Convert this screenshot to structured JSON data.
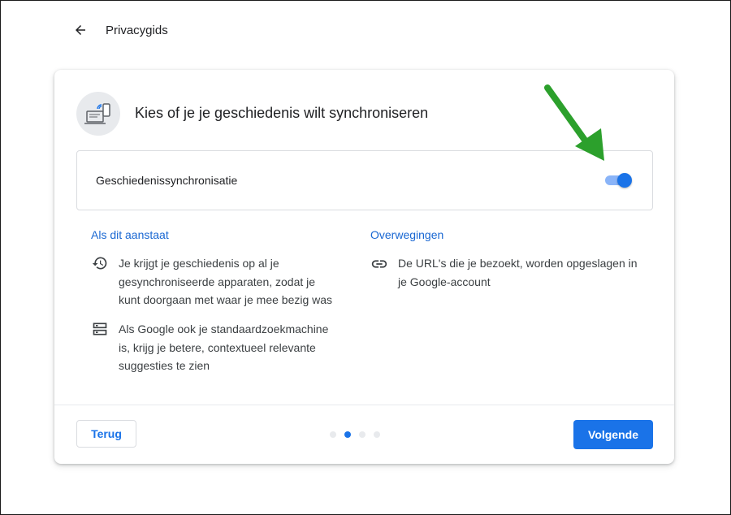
{
  "page": {
    "title": "Privacygids"
  },
  "card": {
    "title": "Kies of je je geschiedenis wilt synchroniseren",
    "toggle": {
      "label": "Geschiedenissynchronisatie",
      "state": "on"
    }
  },
  "columns": [
    {
      "heading": "Als dit aanstaat",
      "items": [
        {
          "icon": "history-icon",
          "text": "Je krijgt je geschiedenis op al je gesynchroniseerde apparaten, zodat je kunt doorgaan met waar je mee bezig was"
        },
        {
          "icon": "storage-icon",
          "text": "Als Google ook je standaardzoekmachine is, krijg je betere, contextueel relevante suggesties te zien"
        }
      ]
    },
    {
      "heading": "Overwegingen",
      "items": [
        {
          "icon": "link-icon",
          "text": "De URL's die je bezoekt, worden opgeslagen in je Google-account"
        }
      ]
    }
  ],
  "footer": {
    "back_label": "Terug",
    "next_label": "Volgende",
    "steps_total": 4,
    "step_current": 2
  },
  "colors": {
    "accent": "#1a73e8",
    "heading": "#1967d2",
    "annotation_arrow": "#2ca02c"
  }
}
